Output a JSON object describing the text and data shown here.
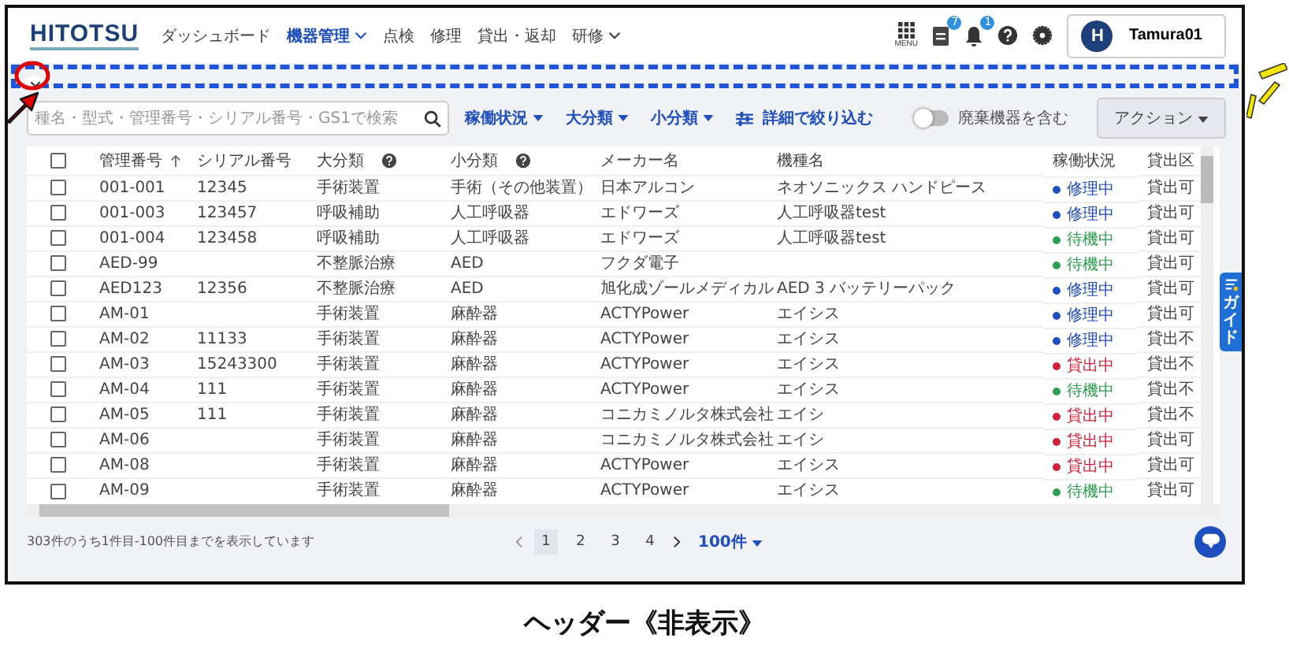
{
  "header": {
    "logo": "HITOTSU",
    "nav": [
      {
        "label": "ダッシュボード",
        "selected": false,
        "dropdown": false
      },
      {
        "label": "機器管理",
        "selected": true,
        "dropdown": true
      },
      {
        "label": "点検",
        "selected": false,
        "dropdown": false
      },
      {
        "label": "修理",
        "selected": false,
        "dropdown": false
      },
      {
        "label": "貸出・返却",
        "selected": false,
        "dropdown": false
      },
      {
        "label": "研修",
        "selected": false,
        "dropdown": true
      }
    ],
    "menu_label": "MENU",
    "document_badge": "7",
    "notification_badge": "1",
    "user": {
      "initial": "H",
      "name": "Tamura01"
    }
  },
  "toolbar": {
    "search": {
      "placeholder": "種名・型式・管理番号・シリアル番号・GS1で検索"
    },
    "filters": [
      {
        "label": "稼働状況",
        "kind": "dropdown"
      },
      {
        "label": "大分類",
        "kind": "dropdown"
      },
      {
        "label": "小分類",
        "kind": "dropdown"
      },
      {
        "label": "詳細で絞り込む",
        "kind": "advanced"
      }
    ],
    "toggle": {
      "label": "廃棄機器を含む",
      "on": false
    },
    "action": "アクション"
  },
  "table": {
    "select_all": {
      "checked": false
    },
    "columns": [
      {
        "label": "管理番号",
        "sorted": true,
        "help": false
      },
      {
        "label": "シリアル番号",
        "sorted": false,
        "help": false
      },
      {
        "label": "大分類",
        "sorted": false,
        "help": true
      },
      {
        "label": "小分類",
        "sorted": false,
        "help": true
      },
      {
        "label": "メーカー名",
        "sorted": false,
        "help": false
      },
      {
        "label": "機種名",
        "sorted": false,
        "help": false
      },
      {
        "label": "稼働状況",
        "sorted": false,
        "help": false
      },
      {
        "label": "貸出区",
        "sorted": false,
        "help": false
      }
    ],
    "rows": [
      {
        "checked": false,
        "cells": [
          "001-001",
          "12345",
          "手術装置",
          "手術（その他装置）",
          "日本アルコン",
          "ネオソニックス ハンドピース"
        ],
        "status": {
          "label": "修理中",
          "color": "#1f4fbf"
        },
        "lending": "貸出可"
      },
      {
        "checked": false,
        "cells": [
          "001-003",
          "123457",
          "呼吸補助",
          "人工呼吸器",
          "エドワーズ",
          "人工呼吸器test"
        ],
        "status": {
          "label": "修理中",
          "color": "#1f4fbf"
        },
        "lending": "貸出可"
      },
      {
        "checked": false,
        "cells": [
          "001-004",
          "123458",
          "呼吸補助",
          "人工呼吸器",
          "エドワーズ",
          "人工呼吸器test"
        ],
        "status": {
          "label": "待機中",
          "color": "#2e9e4f"
        },
        "lending": "貸出可"
      },
      {
        "checked": false,
        "cells": [
          "AED-99",
          "",
          "不整脈治療",
          "AED",
          "フクダ電子",
          ""
        ],
        "status": {
          "label": "待機中",
          "color": "#2e9e4f"
        },
        "lending": "貸出可"
      },
      {
        "checked": false,
        "cells": [
          "AED123",
          "12356",
          "不整脈治療",
          "AED",
          "旭化成ゾールメディカル",
          "AED 3 バッテリーパック"
        ],
        "status": {
          "label": "修理中",
          "color": "#1f4fbf"
        },
        "lending": "貸出可"
      },
      {
        "checked": false,
        "cells": [
          "AM-01",
          "",
          "手術装置",
          "麻酔器",
          "ACTYPower",
          "エイシス"
        ],
        "status": {
          "label": "修理中",
          "color": "#1f4fbf"
        },
        "lending": "貸出可"
      },
      {
        "checked": false,
        "cells": [
          "AM-02",
          "11133",
          "手術装置",
          "麻酔器",
          "ACTYPower",
          "エイシス"
        ],
        "status": {
          "label": "修理中",
          "color": "#1f4fbf"
        },
        "lending": "貸出不"
      },
      {
        "checked": false,
        "cells": [
          "AM-03",
          "15243300",
          "手術装置",
          "麻酔器",
          "ACTYPower",
          "エイシス"
        ],
        "status": {
          "label": "貸出中",
          "color": "#d0223a"
        },
        "lending": "貸出不"
      },
      {
        "checked": false,
        "cells": [
          "AM-04",
          "111",
          "手術装置",
          "麻酔器",
          "ACTYPower",
          "エイシス"
        ],
        "status": {
          "label": "待機中",
          "color": "#2e9e4f"
        },
        "lending": "貸出不"
      },
      {
        "checked": false,
        "cells": [
          "AM-05",
          "111",
          "手術装置",
          "麻酔器",
          "コニカミノルタ株式会社",
          "エイシ"
        ],
        "status": {
          "label": "貸出中",
          "color": "#d0223a"
        },
        "lending": "貸出不"
      },
      {
        "checked": false,
        "cells": [
          "AM-06",
          "",
          "手術装置",
          "麻酔器",
          "コニカミノルタ株式会社",
          "エイシ"
        ],
        "status": {
          "label": "貸出中",
          "color": "#d0223a"
        },
        "lending": "貸出可"
      },
      {
        "checked": false,
        "cells": [
          "AM-08",
          "",
          "手術装置",
          "麻酔器",
          "ACTYPower",
          "エイシス"
        ],
        "status": {
          "label": "貸出中",
          "color": "#d0223a"
        },
        "lending": "貸出可"
      },
      {
        "checked": false,
        "cells": [
          "AM-09",
          "",
          "手術装置",
          "麻酔器",
          "ACTYPower",
          "エイシス"
        ],
        "status": {
          "label": "待機中",
          "color": "#2e9e4f"
        },
        "lending": "貸出可"
      }
    ]
  },
  "footer": {
    "summary": "303件のうち1件目-100件目までを表示しています",
    "pages": [
      {
        "label": "1",
        "selected": true
      },
      {
        "label": "2",
        "selected": false
      },
      {
        "label": "3",
        "selected": false
      },
      {
        "label": "4",
        "selected": false
      }
    ],
    "page_size": "100件"
  },
  "guide": "ガイド",
  "caption": "ヘッダー《非表示》"
}
